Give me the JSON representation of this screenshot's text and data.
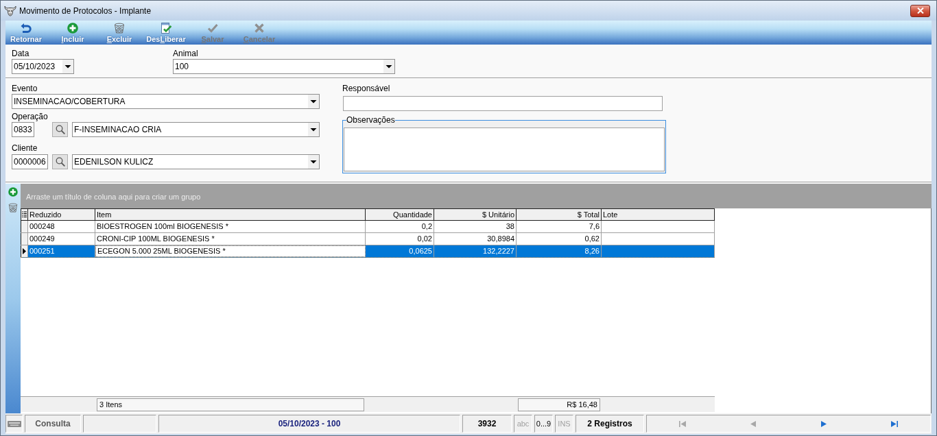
{
  "window": {
    "title": "Movimento de Protocolos - Implante"
  },
  "toolbar": [
    {
      "kind": "return",
      "parts": [
        {
          "text": "Retornar",
          "underlined": false
        }
      ],
      "disabled": false
    },
    {
      "kind": "add",
      "parts": [
        {
          "text": "I",
          "underlined": true
        },
        {
          "text": "ncluir",
          "underlined": false
        }
      ],
      "disabled": false
    },
    {
      "kind": "delete",
      "parts": [
        {
          "text": "E",
          "underlined": true
        },
        {
          "text": "xcluir",
          "underlined": false
        }
      ],
      "disabled": false
    },
    {
      "kind": "release",
      "parts": [
        {
          "text": "Des",
          "underlined": false
        },
        {
          "text": "L",
          "underlined": true
        },
        {
          "text": "iberar",
          "underlined": false
        }
      ],
      "disabled": false
    },
    {
      "kind": "save",
      "parts": [
        {
          "text": "S",
          "underlined": true
        },
        {
          "text": "alvar",
          "underlined": false
        }
      ],
      "disabled": true
    },
    {
      "kind": "cancel",
      "parts": [
        {
          "text": "C",
          "underlined": true
        },
        {
          "text": "ancelar",
          "underlined": false
        }
      ],
      "disabled": true
    }
  ],
  "date": {
    "label": "Data",
    "value": "05/10/2023"
  },
  "animal": {
    "label": "Animal",
    "value": "100"
  },
  "event": {
    "label": "Evento",
    "value": "INSEMINACAO/COBERTURA"
  },
  "operation": {
    "label": "Operação",
    "code": "0833",
    "value": "F-INSEMINACAO CRIA"
  },
  "client": {
    "label": "Cliente",
    "code": "0000006",
    "value": "EDENILSON KULICZ"
  },
  "responsible": {
    "label": "Responsável"
  },
  "observations": {
    "label": "Observações"
  },
  "grid": {
    "group_hint": "Arraste um título de coluna aqui para criar um grupo",
    "columns": [
      {
        "label": "Reduzido",
        "numeric": false,
        "focused": false
      },
      {
        "label": "Item",
        "numeric": false,
        "focused": true,
        "summary": "3 Itens"
      },
      {
        "label": "Quantidade",
        "numeric": true,
        "focused": false
      },
      {
        "label": "$ Unitário",
        "numeric": true,
        "focused": false
      },
      {
        "label": "$ Total",
        "numeric": true,
        "focused": false,
        "summary": "R$ 16,48"
      },
      {
        "label": "Lote",
        "numeric": false,
        "focused": false
      }
    ],
    "rows": [
      {
        "selected": false,
        "cells": [
          "000248",
          "BIOESTROGEN 100ml BIOGENESIS *",
          "0,2",
          "38",
          "7,6"
        ]
      },
      {
        "selected": false,
        "cells": [
          "000249",
          "CRONI-CIP 100ML BIOGENESIS *",
          "0,02",
          "30,8984",
          "0,62"
        ]
      },
      {
        "selected": true,
        "cells": [
          "000251",
          "ECEGON 5.000 25ML BIOGENESIS *",
          "0,0625",
          "132,2227",
          "8,26"
        ]
      }
    ]
  },
  "status_bar": {
    "mode": "Consulta",
    "record": "05/10/2023 - 100",
    "code": "3932",
    "indicators": [
      {
        "text": "abc",
        "on": false
      },
      {
        "text": "0...9",
        "on": true
      },
      {
        "text": "INS",
        "on": false
      }
    ],
    "count": "2 Registros",
    "nav": [
      {
        "kind": "first",
        "disabled": true
      },
      {
        "kind": "previous",
        "disabled": true
      },
      {
        "kind": "next",
        "disabled": false
      },
      {
        "kind": "last",
        "disabled": false
      }
    ]
  }
}
